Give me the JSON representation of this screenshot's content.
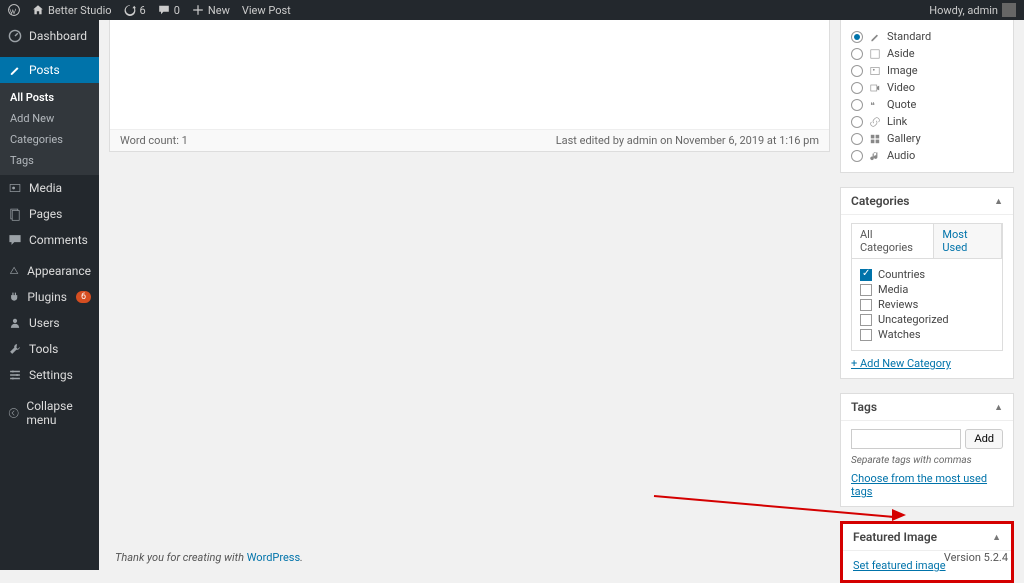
{
  "adminbar": {
    "site": "Better Studio",
    "updates": "6",
    "comments": "0",
    "new": "New",
    "viewpost": "View Post",
    "howdy": "Howdy, admin"
  },
  "sidebar": {
    "dashboard": "Dashboard",
    "posts": "Posts",
    "posts_sub": [
      "All Posts",
      "Add New",
      "Categories",
      "Tags"
    ],
    "media": "Media",
    "pages": "Pages",
    "comments": "Comments",
    "appearance": "Appearance",
    "plugins": "Plugins",
    "plugins_badge": "6",
    "users": "Users",
    "tools": "Tools",
    "settings": "Settings",
    "collapse": "Collapse menu"
  },
  "editor": {
    "wordcount_label": "Word count: 1",
    "lastedit": "Last edited by admin on November 6, 2019 at 1:16 pm"
  },
  "formats": {
    "title": "",
    "items": [
      "Standard",
      "Aside",
      "Image",
      "Video",
      "Quote",
      "Link",
      "Gallery",
      "Audio"
    ],
    "selected": "Standard"
  },
  "categories": {
    "title": "Categories",
    "tabs": [
      "All Categories",
      "Most Used"
    ],
    "items": [
      {
        "label": "Countries",
        "checked": true
      },
      {
        "label": "Media",
        "checked": false
      },
      {
        "label": "Reviews",
        "checked": false
      },
      {
        "label": "Uncategorized",
        "checked": false
      },
      {
        "label": "Watches",
        "checked": false
      }
    ],
    "addnew": "+ Add New Category"
  },
  "tags": {
    "title": "Tags",
    "add": "Add",
    "hint": "Separate tags with commas",
    "choose": "Choose from the most used tags"
  },
  "featured": {
    "title": "Featured Image",
    "set": "Set featured image"
  },
  "footer": {
    "thanks_prefix": "Thank you for creating with ",
    "wp": "WordPress",
    "version": "Version 5.2.4"
  }
}
